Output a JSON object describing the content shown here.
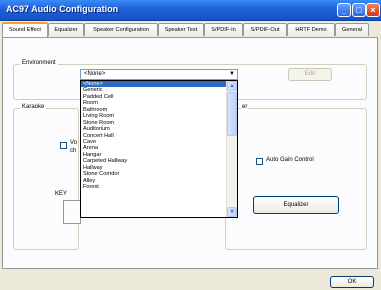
{
  "window": {
    "title": "AC97 Audio Configuration",
    "buttons": {
      "minimize": "_",
      "maximize": "□",
      "close": "×"
    }
  },
  "tabs": [
    "Sound Effect",
    "Equalizer",
    "Speaker Configuration",
    "Speaker Test",
    "S/PDIF-In",
    "S/PDIF-Out",
    "HRTF Demo",
    "General"
  ],
  "active_tab": "Sound Effect",
  "environment": {
    "group_label": "Environment",
    "selected_value": "<None>",
    "edit_button": "Edit",
    "dropdown_options": [
      "<None>",
      "Generic",
      "Padded Cell",
      "Room",
      "Bathroom",
      "Living Room",
      "Stone Room",
      "Auditorium",
      "Concert Hall",
      "Cave",
      "Arena",
      "Hangar",
      "Carpeted Hallway",
      "Hallway",
      "Stone Corridor",
      "Alley",
      "Forest"
    ]
  },
  "karaoke": {
    "group_label": "Karaoke",
    "voice_checkbox_label_line1": "Vo",
    "voice_checkbox_label_line2": "ch",
    "key_label": "KEY"
  },
  "right_group": {
    "label_fragment": "er",
    "auto_gain_label": "Auto Gain Control",
    "equalizer_button": "Equalizer"
  },
  "footer": {
    "ok_button": "OK"
  }
}
